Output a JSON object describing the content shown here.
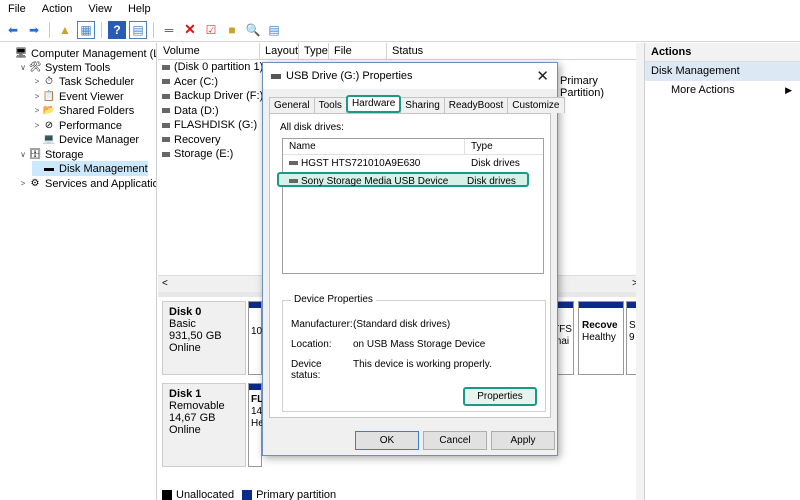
{
  "menu": [
    "File",
    "Action",
    "View",
    "Help"
  ],
  "toolbar": {
    "icons": [
      "back-arrow-icon",
      "forward-arrow-icon",
      "up-folder-icon",
      "show-tree-icon",
      "help-icon",
      "console-icon",
      "connect-icon",
      "delete-icon",
      "check-icon",
      "folder-new-icon",
      "find-icon",
      "properties-icon"
    ]
  },
  "tree": {
    "items": [
      {
        "label": "Computer Management (Local",
        "indent": 0,
        "twisty": "",
        "icon": "🖥"
      },
      {
        "label": "System Tools",
        "indent": 1,
        "twisty": "∨",
        "icon": "🛠"
      },
      {
        "label": "Task Scheduler",
        "indent": 2,
        "twisty": ">",
        "icon": "⏱"
      },
      {
        "label": "Event Viewer",
        "indent": 2,
        "twisty": ">",
        "icon": "📋"
      },
      {
        "label": "Shared Folders",
        "indent": 2,
        "twisty": ">",
        "icon": "📂"
      },
      {
        "label": "Performance",
        "indent": 2,
        "twisty": ">",
        "icon": "⊘"
      },
      {
        "label": "Device Manager",
        "indent": 2,
        "twisty": "",
        "icon": "💻"
      },
      {
        "label": "Storage",
        "indent": 1,
        "twisty": "∨",
        "icon": "🗄"
      },
      {
        "label": "Disk Management",
        "indent": 2,
        "twisty": "",
        "icon": "▬"
      },
      {
        "label": "Services and Applications",
        "indent": 1,
        "twisty": ">",
        "icon": "⚙"
      }
    ]
  },
  "volumes": {
    "columns": [
      "Volume",
      "Layout",
      "Type",
      "File System",
      "Status"
    ],
    "rows": [
      "(Disk 0 partition 1)",
      "Acer (C:)",
      "Backup Driver (F:)",
      "Data (D:)",
      "FLASHDISK (G:)",
      "Recovery",
      "Storage (E:)"
    ],
    "right_text": "Primary Partition)"
  },
  "disks": [
    {
      "name": "Disk 0",
      "kind": "Basic",
      "size": "931,50 GB",
      "status": "Online",
      "part_text": "10"
    },
    {
      "name": "Disk 1",
      "kind": "Removable",
      "size": "14,67 GB",
      "status": "Online",
      "part_text": "FL"
    }
  ],
  "disk0_right": {
    "fs": "TFS",
    "sub": "mai",
    "rec_title": "Recove",
    "rec_sub": "Healthy"
  },
  "legend": {
    "unallocated": "Unallocated",
    "primary": "Primary partition"
  },
  "colors": {
    "teal": "#1a9a86",
    "primary_bar": "#0b2b8c"
  },
  "actions": {
    "title": "Actions",
    "section": "Disk Management",
    "more": "More Actions"
  },
  "dialog": {
    "title": "USB Drive (G:) Properties",
    "tabs": [
      "General",
      "Tools",
      "Hardware",
      "Sharing",
      "ReadyBoost",
      "Customize"
    ],
    "active_tab": "Hardware",
    "all_disks_label": "All disk drives:",
    "list_columns": [
      "Name",
      "Type"
    ],
    "drives": [
      {
        "name": "HGST HTS721010A9E630",
        "type": "Disk drives"
      },
      {
        "name": "Sony Storage Media USB Device",
        "type": "Disk drives"
      }
    ],
    "device_props": {
      "title": "Device Properties",
      "manufacturer_label": "Manufacturer:",
      "manufacturer": "(Standard disk drives)",
      "location_label": "Location:",
      "location": "on USB Mass Storage Device",
      "status_label": "Device status:",
      "status": "This device is working properly."
    },
    "properties_btn": "Properties",
    "ok": "OK",
    "cancel": "Cancel",
    "apply": "Apply"
  }
}
